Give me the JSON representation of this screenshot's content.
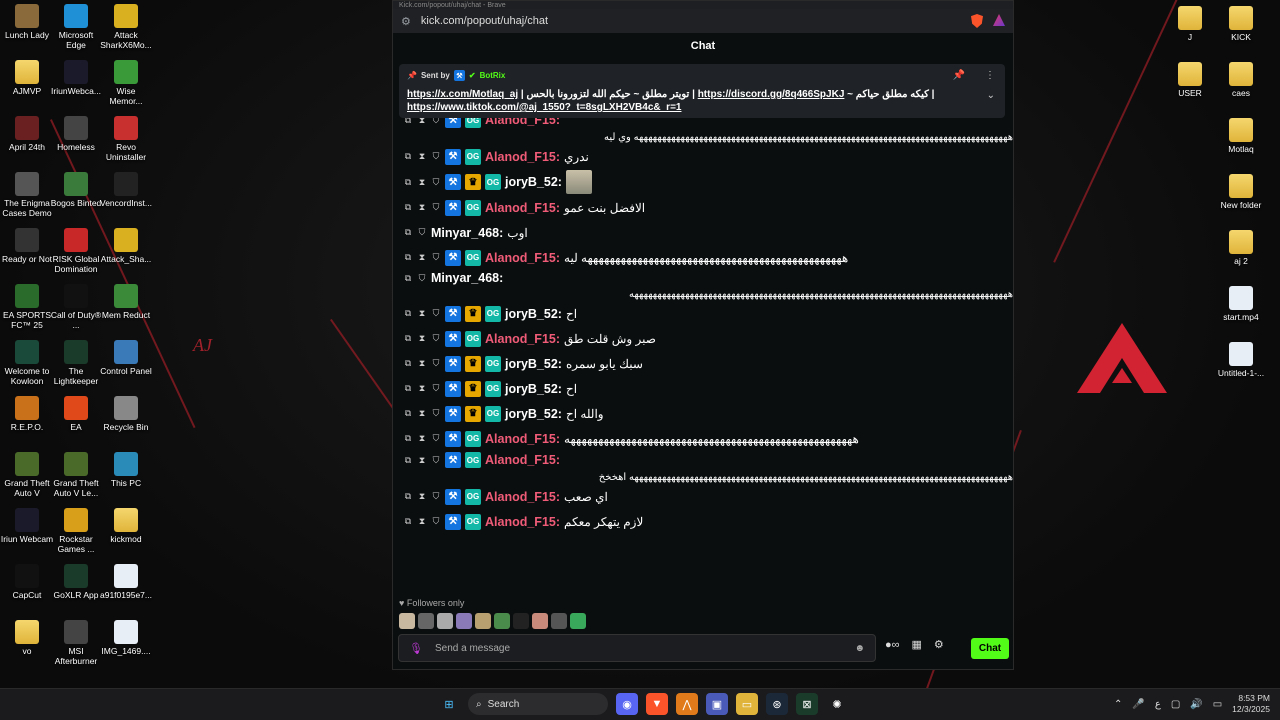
{
  "browser": {
    "title": "Kick.com/popout/uhaj/chat - Brave",
    "url": "kick.com/popout/uhaj/chat"
  },
  "chat": {
    "header": "Chat",
    "pinned": {
      "sent_by_label": "Sent by",
      "bot_name": "BotRix",
      "line1_prefix": "https://x.com/Motlaq_aj",
      "line1_mid": "تويتر مطلق ~ حيكم الله لتزورونا بالحس",
      "line1_link2": "https://discord.gg/8q466SpJKJ",
      "line1_suffix": "~ كيكه مطلق حياكم",
      "line2": "https://www.tiktok.com/@aj_1550?_t=8sgLXH2VB4c&_r=1"
    },
    "messages": [
      {
        "user": "Alanod_F15",
        "color": "#f05c78",
        "badges": [
          "mod",
          "og"
        ],
        "text": "هههههههههههههههههههههههههههههههههههههههههههههههههههههههههههههههههههههههههههههههههه وي ليه",
        "long": true
      },
      {
        "user": "Alanod_F15",
        "color": "#f05c78",
        "badges": [
          "mod",
          "og"
        ],
        "text": "ندري"
      },
      {
        "user": "joryB_52",
        "color": "#ffffff",
        "badges": [
          "mod",
          "vip",
          "og"
        ],
        "text": "",
        "emote": true
      },
      {
        "user": "Alanod_F15",
        "color": "#f05c78",
        "badges": [
          "mod",
          "og"
        ],
        "text": "الافضل بنت عمو"
      },
      {
        "user": "Minyar_468",
        "color": "#ffffff",
        "badges": [],
        "text": "اوب"
      },
      {
        "user": "Alanod_F15",
        "color": "#f05c78",
        "badges": [
          "mod",
          "og"
        ],
        "text": "هههههههههههههههههههههههههههههههههههههههههههههههه ليه"
      },
      {
        "user": "Minyar_468",
        "color": "#ffffff",
        "badges": [],
        "text": "ههههههههههههههههههههههههههههههههههههههههههههههههههههههههههههههههههههههههههههههههههه",
        "long": true
      },
      {
        "user": "joryB_52",
        "color": "#ffffff",
        "badges": [
          "mod",
          "vip",
          "og"
        ],
        "text": "اح"
      },
      {
        "user": "Alanod_F15",
        "color": "#f05c78",
        "badges": [
          "mod",
          "og"
        ],
        "text": "صبر وش قلت طق"
      },
      {
        "user": "joryB_52",
        "color": "#ffffff",
        "badges": [
          "mod",
          "vip",
          "og"
        ],
        "text": "سبك يابو سمره"
      },
      {
        "user": "joryB_52",
        "color": "#ffffff",
        "badges": [
          "mod",
          "vip",
          "og"
        ],
        "text": "اح"
      },
      {
        "user": "joryB_52",
        "color": "#ffffff",
        "badges": [
          "mod",
          "vip",
          "og"
        ],
        "text": "والله اح"
      },
      {
        "user": "Alanod_F15",
        "color": "#f05c78",
        "badges": [
          "mod",
          "og"
        ],
        "text": "ههههههههههههههههههههههههههههههههههههههههههههههههههههه"
      },
      {
        "user": "Alanod_F15",
        "color": "#f05c78",
        "badges": [
          "mod",
          "og"
        ],
        "text": "ههههههههههههههههههههههههههههههههههههههههههههههههههههههههههههههههههههههههههههههههههه اهخخخ",
        "long": true
      },
      {
        "user": "Alanod_F15",
        "color": "#f05c78",
        "badges": [
          "mod",
          "og"
        ],
        "text": "اي صعب"
      },
      {
        "user": "Alanod_F15",
        "color": "#f05c78",
        "badges": [
          "mod",
          "og"
        ],
        "text": "لازم يتهكر معكم"
      }
    ],
    "followers_only": "Followers only",
    "input_placeholder": "Send a message",
    "send_label": "Chat"
  },
  "desktop_icons_left": [
    {
      "label": "Lunch Lady",
      "color": "#8a6a3a"
    },
    {
      "label": "Microsoft Edge",
      "color": "#1f8fd6"
    },
    {
      "label": "Attack SharkX6Mo...",
      "color": "#d8b020"
    },
    {
      "label": "AJMVP",
      "color": "#e0b43a",
      "folder": true
    },
    {
      "label": "IriunWebca...",
      "color": "#1a1a2a"
    },
    {
      "label": "Wise Memor...",
      "color": "#3a9a3a"
    },
    {
      "label": "April 24th",
      "color": "#6a2020"
    },
    {
      "label": "Homeless",
      "color": "#444444"
    },
    {
      "label": "Revo Uninstaller",
      "color": "#c83030"
    },
    {
      "label": "The Enigma Cases Demo",
      "color": "#555555"
    },
    {
      "label": "Bogos Binted",
      "color": "#3a7a3a"
    },
    {
      "label": "VencordInst...",
      "color": "#222222"
    },
    {
      "label": "Ready or Not",
      "color": "#333333"
    },
    {
      "label": "RISK Global Domination",
      "color": "#c82828"
    },
    {
      "label": "Attack_Sha...",
      "color": "#d8b020"
    },
    {
      "label": "EA SPORTS FC™ 25",
      "color": "#2a6a2a"
    },
    {
      "label": "Call of Duty® ...",
      "color": "#111111"
    },
    {
      "label": "Mem Reduct",
      "color": "#3a8a3a"
    },
    {
      "label": "Welcome to Kowloon",
      "color": "#1a4a3a"
    },
    {
      "label": "The Lightkeeper",
      "color": "#1a3a2a"
    },
    {
      "label": "Control Panel",
      "color": "#3a7ab8"
    },
    {
      "label": "R.E.P.O.",
      "color": "#c8701a"
    },
    {
      "label": "EA",
      "color": "#e04a1a"
    },
    {
      "label": "Recycle Bin",
      "color": "#888888"
    },
    {
      "label": "Grand Theft Auto V",
      "color": "#4a6a2a"
    },
    {
      "label": "Grand Theft Auto V Le...",
      "color": "#4a6a2a"
    },
    {
      "label": "This PC",
      "color": "#2a8ab8"
    },
    {
      "label": "Iriun Webcam",
      "color": "#1a1a2a"
    },
    {
      "label": "Rockstar Games ...",
      "color": "#d8a01a"
    },
    {
      "label": "kickmod",
      "color": "#e0b43a",
      "folder": true
    },
    {
      "label": "CapCut",
      "color": "#111111"
    },
    {
      "label": "GoXLR App",
      "color": "#1a3a2a"
    },
    {
      "label": "a91f0195e7...",
      "color": "#e8eef6",
      "file": true
    },
    {
      "label": "vo",
      "color": "#e0b43a",
      "folder": true
    },
    {
      "label": "MSI Afterburner",
      "color": "#444444"
    },
    {
      "label": "IMG_1469....",
      "color": "#e8eef6",
      "file": true
    }
  ],
  "desktop_icons_right": [
    {
      "label": "J",
      "folder": true
    },
    {
      "label": "KICK",
      "folder": true
    },
    {
      "label": "USER",
      "folder": true
    },
    {
      "label": "caes",
      "folder": true
    },
    {
      "label": "Motlaq",
      "folder": true
    },
    {
      "label": "New folder",
      "folder": true
    },
    {
      "label": "aj 2",
      "folder": true
    },
    {
      "label": "start.mp4",
      "file": true
    },
    {
      "label": "Untitled-1-...",
      "file": true
    }
  ],
  "decor": {
    "aj_mark": "AJ"
  },
  "taskbar": {
    "search_label": "Search",
    "time": "8:53 PM",
    "date": "12/3/2025",
    "lang": "ع"
  }
}
